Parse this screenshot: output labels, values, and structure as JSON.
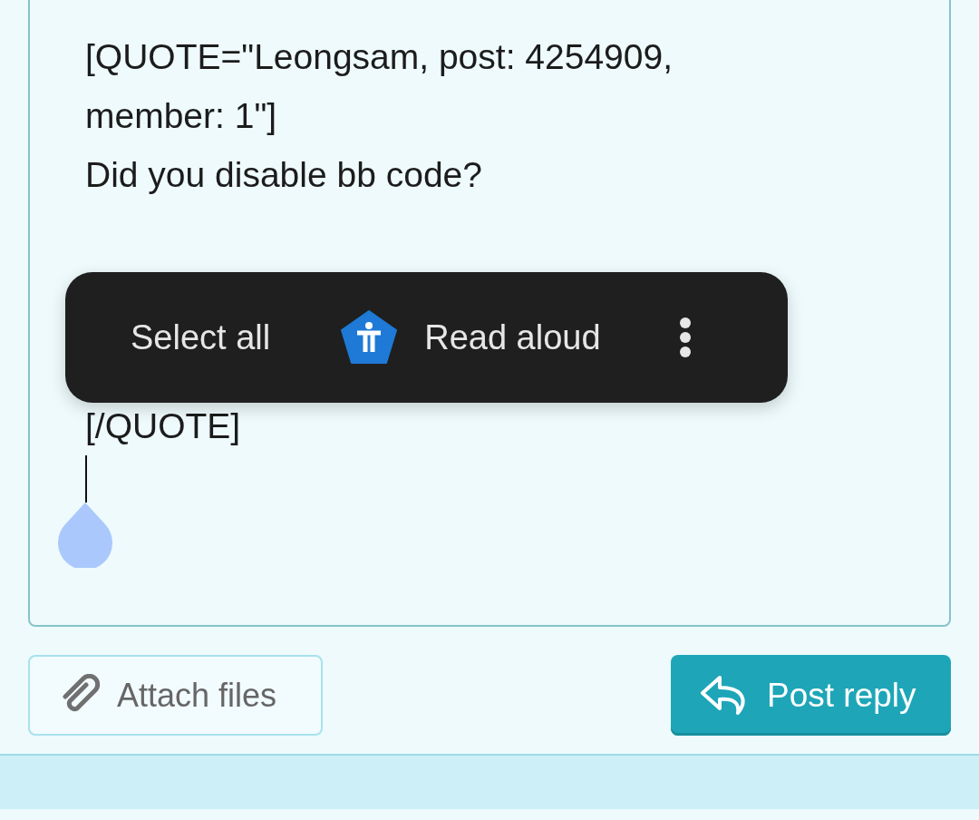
{
  "editor": {
    "lines": [
      {
        "text": "[QUOTE=\"Leongsam, post: 4254909, member: 1\"]"
      },
      {
        "text": "Did you disable bb code?"
      },
      {
        "text": "[/QUOTE]"
      }
    ]
  },
  "context_menu": {
    "items": [
      {
        "kind": "text",
        "label": "Select all"
      },
      {
        "kind": "icon-text",
        "label": "Read aloud"
      },
      {
        "kind": "more"
      }
    ]
  },
  "buttons": [
    {
      "kind": "attach",
      "label": "Attach files"
    },
    {
      "kind": "post",
      "label": "Post reply"
    }
  ]
}
